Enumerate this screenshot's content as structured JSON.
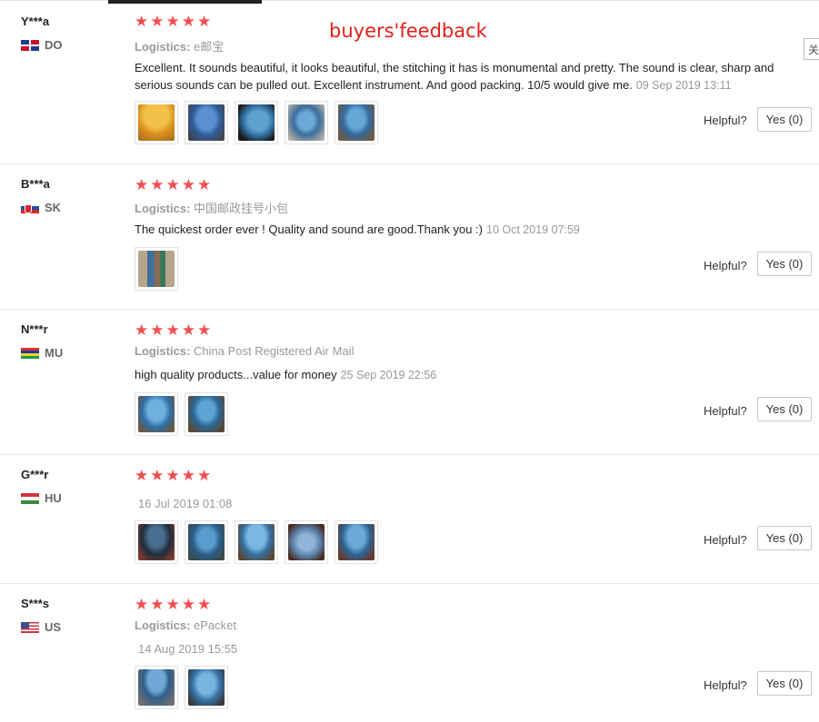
{
  "banner": "buyers'feedback",
  "side_tab_label": "关",
  "star_glyph": "★",
  "helpful_label": "Helpful?",
  "reviews": [
    {
      "user": "Y***a",
      "country": "DO",
      "rating": 5,
      "logistics_label": "Logistics:",
      "logistics_value": "e邮宝",
      "comment": "Excellent. It sounds beautiful, it looks beautiful, the stitching it has is monumental and pretty. The sound is clear, sharp and serious sounds can be pulled out. Excellent instrument. And good packing. 10/5 would give me.",
      "date": "09 Sep 2019 13:11",
      "yes": "Yes (0)",
      "photo_count": 5
    },
    {
      "user": "B***a",
      "country": "SK",
      "rating": 5,
      "logistics_label": "Logistics:",
      "logistics_value": "中国邮政挂号小包",
      "comment": "The quickest order ever ! Quality and sound are good.Thank you :)",
      "date": "10 Oct 2019 07:59",
      "yes": "Yes (0)",
      "photo_count": 1
    },
    {
      "user": "N***r",
      "country": "MU",
      "rating": 5,
      "logistics_label": "Logistics:",
      "logistics_value": "China Post Registered Air Mail",
      "comment": "high quality products...value for money",
      "date": "25 Sep 2019 22:56",
      "yes": "Yes (0)",
      "photo_count": 2
    },
    {
      "user": "G***r",
      "country": "HU",
      "rating": 5,
      "date": "16 Jul 2019 01:08",
      "yes": "Yes (0)",
      "photo_count": 5
    },
    {
      "user": "S***s",
      "country": "US",
      "rating": 5,
      "logistics_label": "Logistics:",
      "logistics_value": "ePacket",
      "date": "14 Aug 2019 15:55",
      "yes": "Yes (0)",
      "photo_count": 2
    }
  ]
}
